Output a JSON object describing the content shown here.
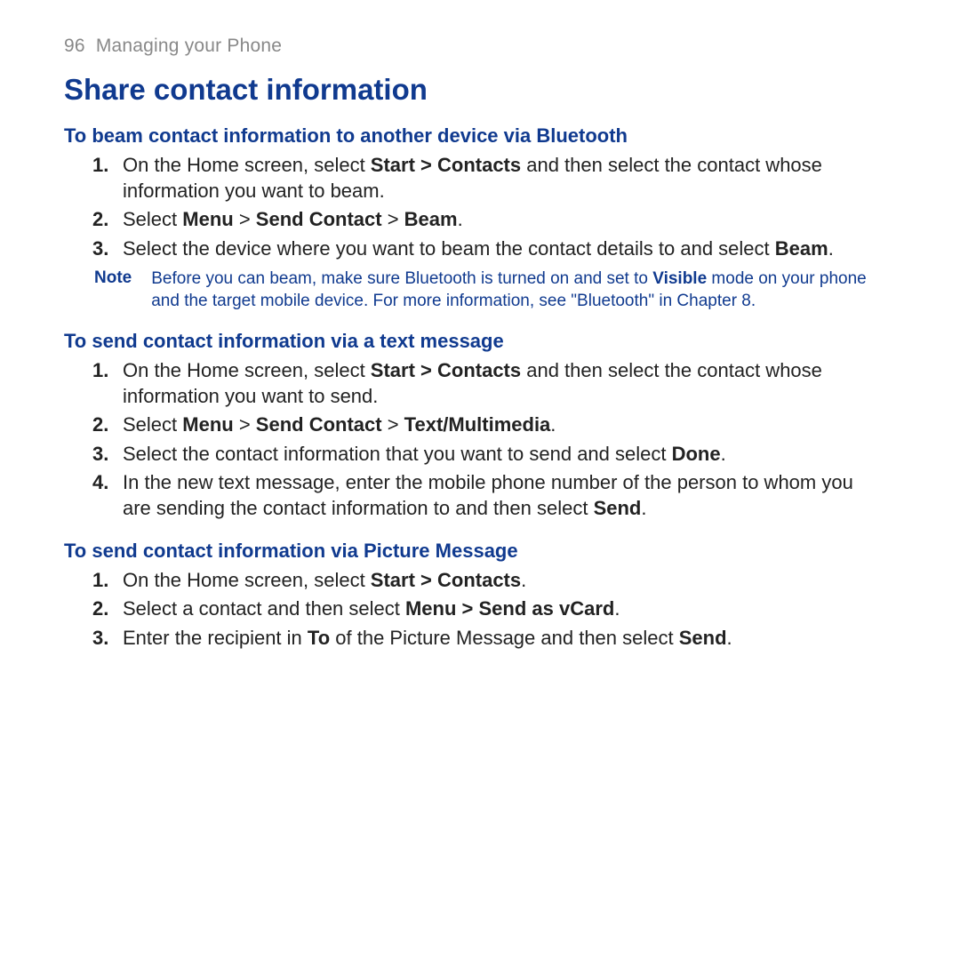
{
  "header": {
    "page_number": "96",
    "chapter": "Managing your Phone"
  },
  "title": "Share contact information",
  "sections": [
    {
      "heading": "To beam contact information to another device via Bluetooth",
      "steps": [
        "On the Home screen, select <b>Start > Contacts</b> and then select the contact whose information you want to beam.",
        "Select <b>Menu</b> > <b>Send Contact</b> > <b>Beam</b>.",
        "Select the device where you want to beam the contact details to and select <b>Beam</b>."
      ],
      "note": {
        "label": "Note",
        "body": "Before you can beam, make sure Bluetooth is turned on and set to <b>Visible</b> mode on your phone and the target mobile device. For more information, see \"Bluetooth\" in Chapter 8."
      }
    },
    {
      "heading": "To send contact information via a text message",
      "steps": [
        "On the Home screen, select <b>Start > Contacts</b> and then select the contact whose information you want to send.",
        "Select <b>Menu</b> > <b>Send Contact</b> > <b>Text/Multimedia</b>.",
        "Select the contact information that you want to send and select <b>Done</b>.",
        "In the new text message, enter the mobile phone number of the person to whom you are sending the contact information to and then select <b>Send</b>."
      ]
    },
    {
      "heading": "To send contact information via Picture Message",
      "steps": [
        "On the Home screen, select <b>Start > Contacts</b>.",
        "Select a contact and then select <b>Menu > Send as vCard</b>.",
        "Enter the recipient in <b>To</b> of the Picture Message and then select <b>Send</b>."
      ]
    }
  ]
}
